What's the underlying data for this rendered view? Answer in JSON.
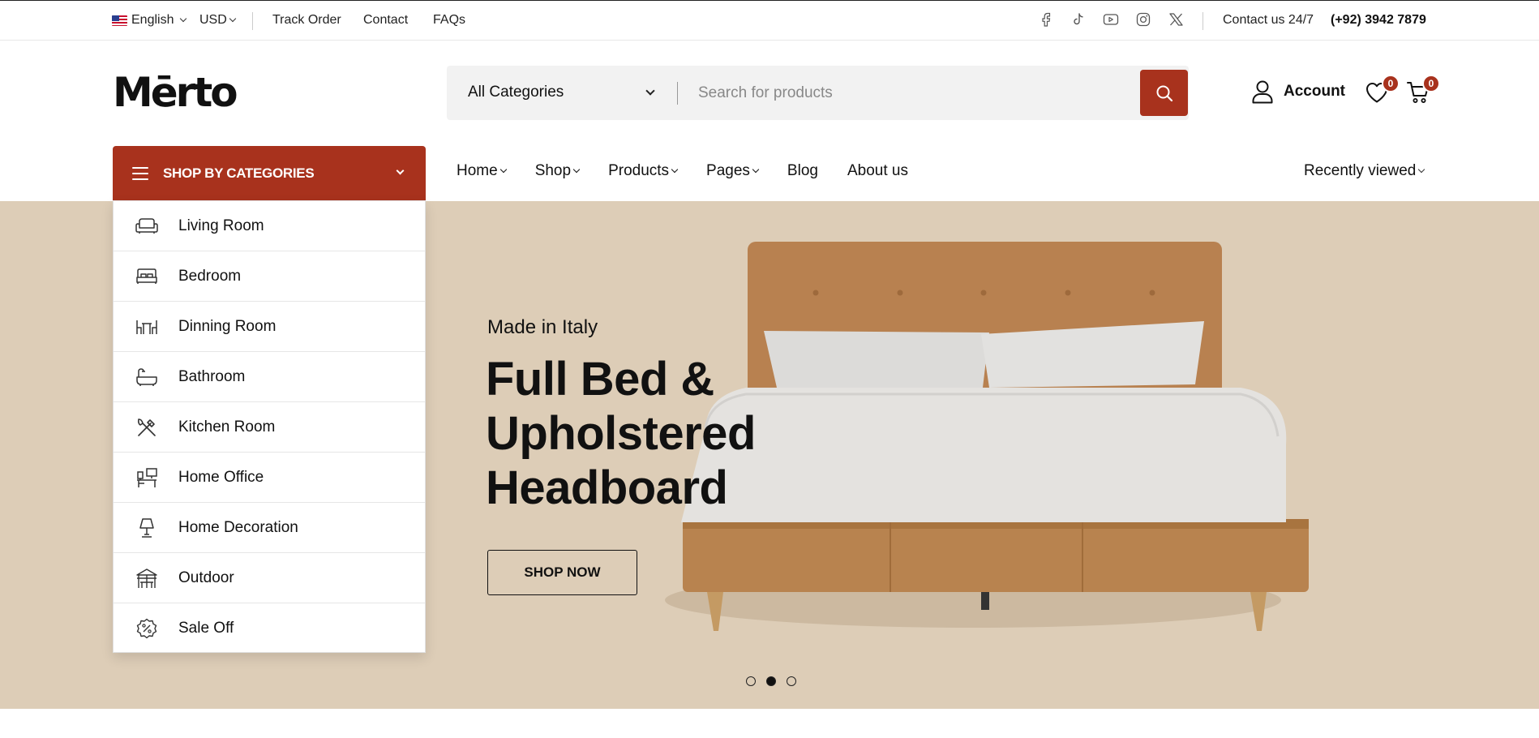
{
  "topbar": {
    "language": "English",
    "currency": "USD",
    "links": [
      "Track Order",
      "Contact",
      "FAQs"
    ],
    "socials": [
      "facebook-icon",
      "tiktok-icon",
      "youtube-icon",
      "instagram-icon",
      "x-icon"
    ],
    "contact_label": "Contact us 24/7",
    "phone": "(+92) 3942 7879"
  },
  "header": {
    "logo": "Mērto",
    "category_select": "All Categories",
    "search_placeholder": "Search for products",
    "account_label": "Account",
    "wishlist_count": "0",
    "cart_count": "0"
  },
  "nav": {
    "categories_button": "SHOP BY CATEGORIES",
    "items": [
      "Home",
      "Shop",
      "Products",
      "Pages",
      "Blog",
      "About us"
    ],
    "recently_viewed": "Recently viewed"
  },
  "categories": [
    {
      "label": "Living Room",
      "icon": "sofa-icon"
    },
    {
      "label": "Bedroom",
      "icon": "bed-icon"
    },
    {
      "label": "Dinning Room",
      "icon": "dining-table-icon"
    },
    {
      "label": "Bathroom",
      "icon": "bathtub-icon"
    },
    {
      "label": "Kitchen Room",
      "icon": "utensils-icon"
    },
    {
      "label": "Home Office",
      "icon": "office-desk-icon"
    },
    {
      "label": "Home Decoration",
      "icon": "lamp-icon"
    },
    {
      "label": "Outdoor",
      "icon": "gazebo-icon"
    },
    {
      "label": "Sale Off",
      "icon": "percent-badge-icon"
    }
  ],
  "hero": {
    "subtitle": "Made in Italy",
    "title_lines": [
      "Full Bed &",
      "Upholstered",
      "Headboard"
    ],
    "cta": "SHOP NOW",
    "slides": 3,
    "active_slide": 2,
    "background": "#ddcdb7"
  },
  "colors": {
    "accent": "#a8321d"
  }
}
